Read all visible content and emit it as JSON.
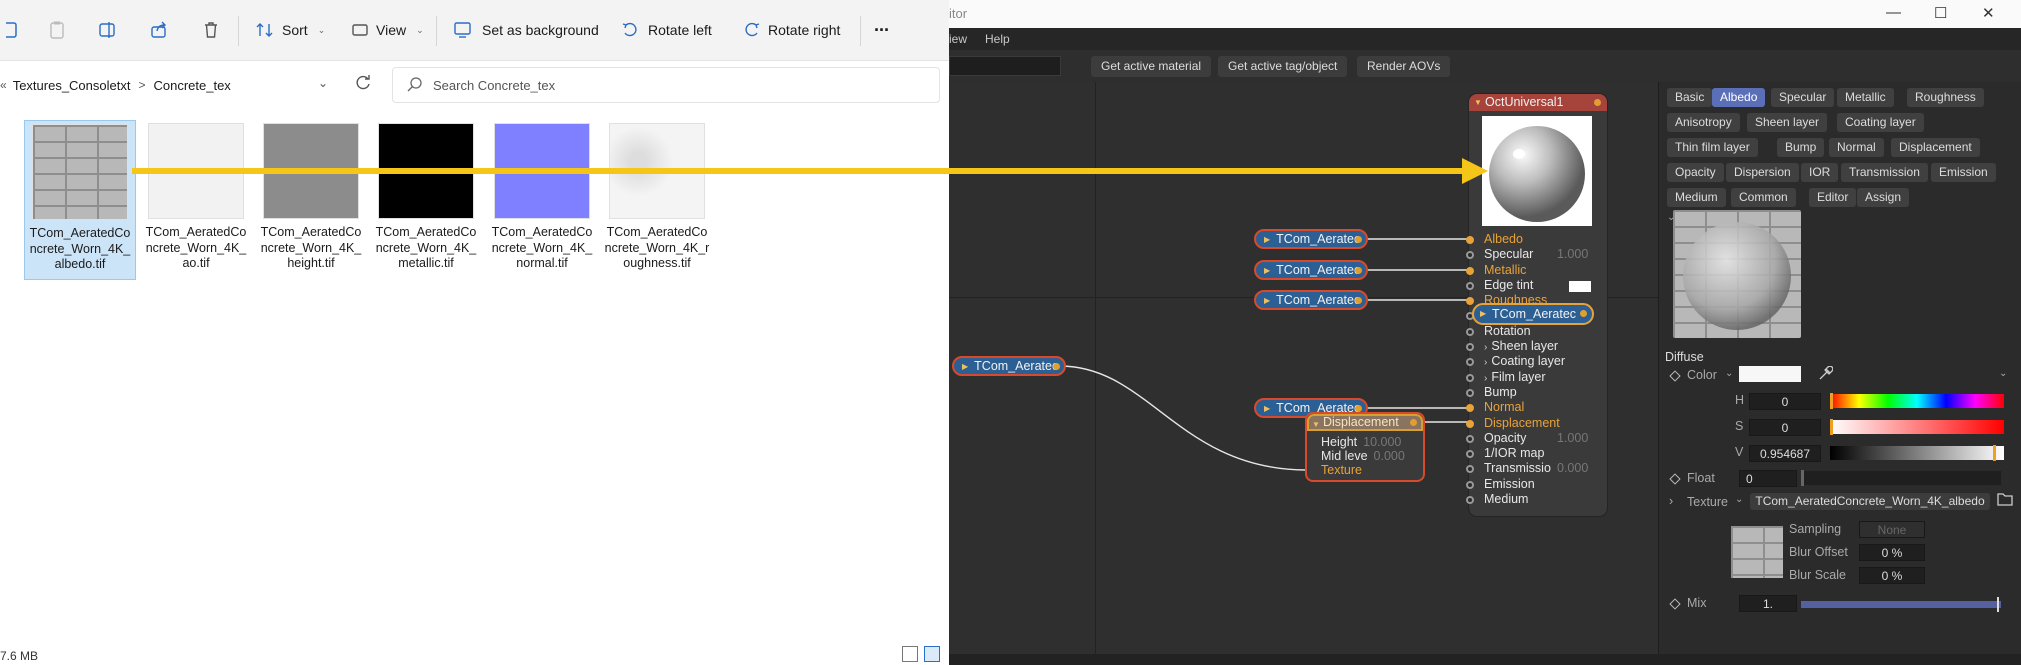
{
  "explorer": {
    "toolbar": {
      "sort_label": "Sort",
      "view_label": "View",
      "set_background_label": "Set as background",
      "rotate_left_label": "Rotate left",
      "rotate_right_label": "Rotate right",
      "more_label": "···"
    },
    "breadcrumb": {
      "prefix": "«",
      "items": [
        "Textures_Consoletxt",
        "Concrete_tex"
      ],
      "separator": ">"
    },
    "search": {
      "placeholder": "Search Concrete_tex"
    },
    "files": [
      {
        "name": "TCom_AeratedConcrete_Worn_4K_albedo.tif",
        "display": "TCom_AeratedCo ncrete_Worn_4K_ albedo.tif",
        "selected": true
      },
      {
        "name": "TCom_AeratedConcrete_Worn_4K_ao.tif",
        "display": "TCom_AeratedCo ncrete_Worn_4K_ ao.tif",
        "selected": false
      },
      {
        "name": "TCom_AeratedConcrete_Worn_4K_height.tif",
        "display": "TCom_AeratedCo ncrete_Worn_4K_ height.tif",
        "selected": false
      },
      {
        "name": "TCom_AeratedConcrete_Worn_4K_metallic.tif",
        "display": "TCom_AeratedCo ncrete_Worn_4K_ metallic.tif",
        "selected": false
      },
      {
        "name": "TCom_AeratedConcrete_Worn_4K_normal.tif",
        "display": "TCom_AeratedCo ncrete_Worn_4K_ normal.tif",
        "selected": false
      },
      {
        "name": "TCom_AeratedConcrete_Worn_4K_roughness.tif",
        "display": "TCom_AeratedCo ncrete_Worn_4K_r oughness.tif",
        "selected": false
      }
    ],
    "status": "7.6 MB"
  },
  "editor": {
    "title": "itor",
    "menu": [
      "iew",
      "Help"
    ],
    "toolbar_buttons": [
      "Get active material",
      "Get active tag/object",
      "Render AOVs"
    ],
    "graph": {
      "material_node": {
        "title": "OctUniversal1",
        "pins": [
          {
            "label": "Albedo",
            "orange": true,
            "filled": true,
            "value": ""
          },
          {
            "label": "Specular",
            "orange": false,
            "filled": false,
            "value": "1.000"
          },
          {
            "label": "Metallic",
            "orange": true,
            "filled": true,
            "value": ""
          },
          {
            "label": "Edge tint",
            "orange": false,
            "filled": false,
            "value": ""
          },
          {
            "label": "Roughness",
            "orange": true,
            "filled": true,
            "value": ""
          },
          {
            "label": "",
            "orange": false,
            "filled": false,
            "value": ""
          },
          {
            "label": "Rotation",
            "orange": false,
            "filled": false,
            "value": ""
          },
          {
            "label": "Sheen layer",
            "orange": false,
            "filled": false,
            "value": "",
            "sub": true
          },
          {
            "label": "Coating layer",
            "orange": false,
            "filled": false,
            "value": "",
            "sub": true
          },
          {
            "label": "Film layer",
            "orange": false,
            "filled": false,
            "value": "",
            "sub": true
          },
          {
            "label": "Bump",
            "orange": false,
            "filled": false,
            "value": ""
          },
          {
            "label": "Normal",
            "orange": true,
            "filled": true,
            "value": ""
          },
          {
            "label": "Displacement",
            "orange": true,
            "filled": true,
            "value": ""
          },
          {
            "label": "Opacity",
            "orange": false,
            "filled": false,
            "value": "1.000"
          },
          {
            "label": "1/IOR map",
            "orange": false,
            "filled": false,
            "value": ""
          },
          {
            "label": "Transmissio",
            "orange": false,
            "filled": false,
            "value": "0.000"
          },
          {
            "label": "Emission",
            "orange": false,
            "filled": false,
            "value": ""
          },
          {
            "label": "Medium",
            "orange": false,
            "filled": false,
            "value": ""
          }
        ]
      },
      "texture_nodes": [
        "TCom_Aeratec",
        "TCom_Aeratec",
        "TCom_Aeratec",
        "TCom_Aeratec",
        "TCom_Aeratec"
      ],
      "selected_node": "TCom_Aeratec",
      "displacement_node": {
        "title": "Displacement",
        "height_label": "Height",
        "height_value": "10.000",
        "mid_label": "Mid leve",
        "mid_value": "0.000",
        "texture_label": "Texture"
      }
    },
    "inspector": {
      "tabs": [
        "Basic",
        "Albedo",
        "Specular",
        "Metallic",
        "Roughness",
        "Anisotropy",
        "Sheen layer",
        "Coating layer",
        "Thin film layer",
        "Bump",
        "Normal",
        "Displacement",
        "Opacity",
        "Dispersion",
        "IOR",
        "Transmission",
        "Emission",
        "Medium",
        "Common",
        "Editor",
        "Assign"
      ],
      "active_tab": "Albedo",
      "section": "Diffuse",
      "color_label": "Color",
      "h_label": "H",
      "h_value": "0",
      "s_label": "S",
      "s_value": "0",
      "v_label": "V",
      "v_value": "0.954687",
      "float_label": "Float",
      "float_value": "0",
      "texture_label": "Texture",
      "texture_name": "TCom_AeratedConcrete_Worn_4K_albedo",
      "sampling_label": "Sampling",
      "sampling_value": "None",
      "blur_offset_label": "Blur Offset",
      "blur_offset_value": "0 %",
      "blur_scale_label": "Blur Scale",
      "blur_scale_value": "0 %",
      "mix_label": "Mix",
      "mix_value": "1.",
      "v_level": 0.954687
    }
  },
  "colors": {
    "arrow": "#f5c518",
    "node_blue": "#2c5f94",
    "node_border": "#d84a2a",
    "pin_orange": "#e8a23a",
    "tab_active": "#5a6fb8"
  }
}
